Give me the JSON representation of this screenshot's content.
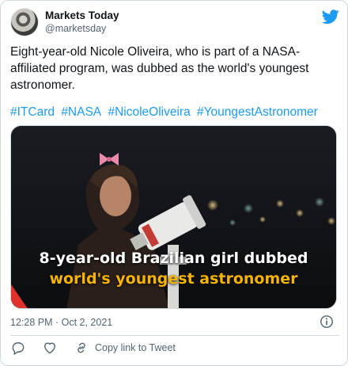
{
  "tweet": {
    "display_name": "Markets Today",
    "handle": "@marketsday",
    "text": "Eight-year-old Nicole Oliveira, who is part of a NASA-affiliated program, was dubbed as the world's youngest astronomer.",
    "hashtags": [
      "#ITCard",
      "#NASA",
      "#NicoleOliveira",
      "#YoungestAstronomer"
    ],
    "media": {
      "caption_line1": "8-year-old Brazilian girl dubbed",
      "caption_line2": "world's youngest astronomer"
    },
    "timestamp": "12:28 PM · Oct 2, 2021",
    "actions": {
      "reply_icon": "reply-icon",
      "like_icon": "heart-icon",
      "copy_icon": "link-icon",
      "copy_label": "Copy link to Tweet"
    }
  },
  "colors": {
    "accent": "#1d9bf0",
    "caption_highlight": "#f5b400",
    "muted": "#536471"
  }
}
